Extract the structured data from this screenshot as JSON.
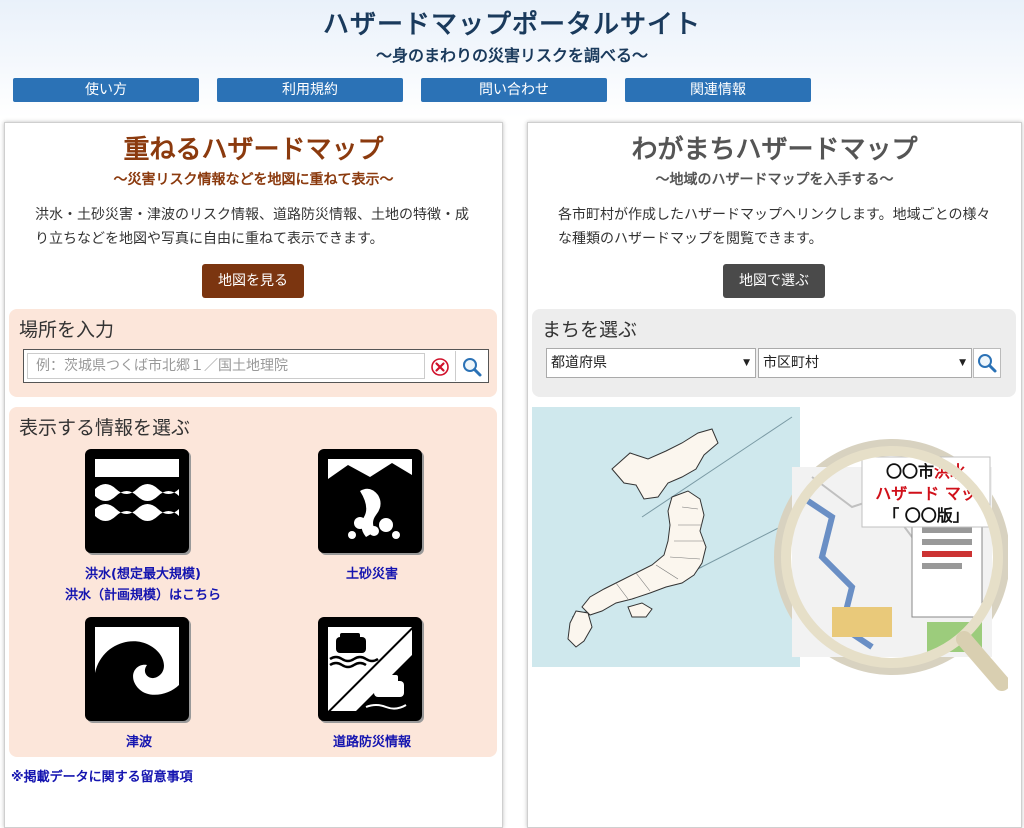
{
  "header": {
    "title": "ハザードマップポータルサイト",
    "subtitle": "～身のまわりの災害リスクを調べる～"
  },
  "nav": [
    {
      "label": "使い方"
    },
    {
      "label": "利用規約"
    },
    {
      "label": "問い合わせ"
    },
    {
      "label": "関連情報"
    }
  ],
  "left": {
    "title": "重ねるハザードマップ",
    "subtitle": "～災害リスク情報などを地図に重ねて表示～",
    "description": "洪水・土砂災害・津波のリスク情報、道路防災情報、土地の特徴・成り立ちなどを地図や写真に自由に重ねて表示できます。",
    "button": "地図を見る",
    "place_box": {
      "title": "場所を入力",
      "placeholder": "例：茨城県つくば市北郷１／国土地理院"
    },
    "info_box": {
      "title": "表示する情報を選ぶ",
      "items": [
        {
          "label": "洪水(想定最大規模)",
          "label2": "洪水（計画規模）はこちら",
          "icon": "flood-icon"
        },
        {
          "label": "土砂災害",
          "icon": "landslide-icon"
        },
        {
          "label": "津波",
          "icon": "tsunami-icon"
        },
        {
          "label": "道路防災情報",
          "icon": "road-disaster-icon"
        }
      ]
    },
    "note": "※掲載データに関する留意事項"
  },
  "right": {
    "title": "わがまちハザードマップ",
    "subtitle": "～地域のハザードマップを入手する～",
    "description": "各市町村が作成したハザードマップへリンクします。地域ごとの様々な種類のハザードマップを閲覧できます。",
    "button": "地図で選ぶ",
    "town_box": {
      "title": "まちを選ぶ",
      "prefecture": "都道府県",
      "city": "市区町村"
    },
    "magnifier": {
      "line1_prefix": "〇〇市",
      "line1_suffix": "洪水",
      "line2": "ハザード マッ",
      "line3": "「 〇〇版」"
    }
  },
  "colors": {
    "header_text": "#1a3a5c",
    "nav_button": "#2b72b6",
    "left_accent": "#8b3a0e",
    "left_button": "#7b3510",
    "left_box_bg": "#fce6da",
    "right_button": "#4a4a4a",
    "right_box_bg": "#ededed",
    "link": "#1515b0",
    "map_sea": "#cfe8ed"
  }
}
